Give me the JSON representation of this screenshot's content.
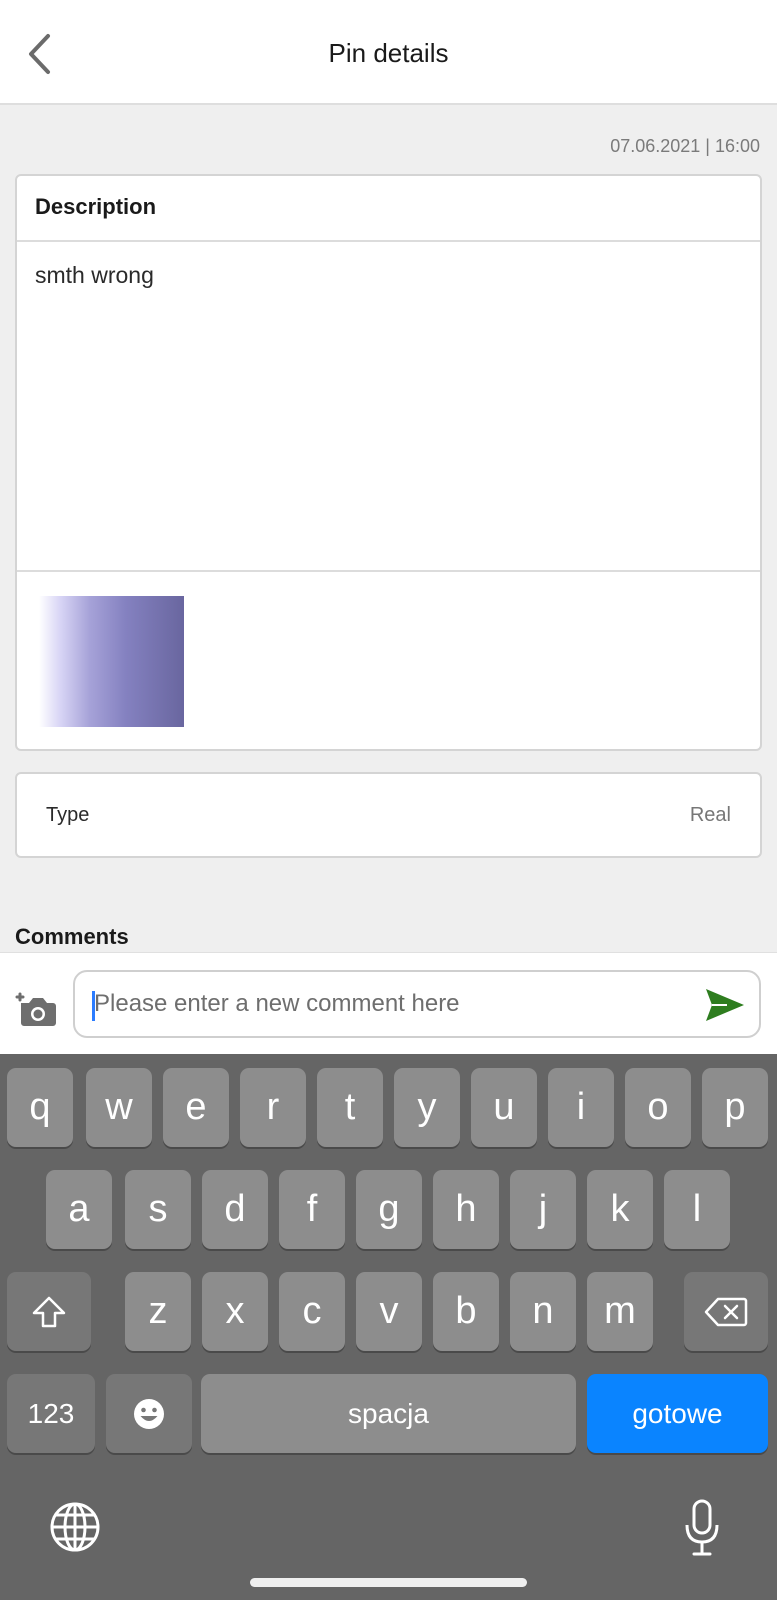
{
  "header": {
    "title": "Pin details",
    "back_icon": "chevron-left-icon"
  },
  "timestamp": "07.06.2021 | 16:00",
  "description": {
    "heading": "Description",
    "text": "smth wrong",
    "attachment_icon": "photo-thumbnail"
  },
  "type_card": {
    "label": "Type",
    "value": "Real"
  },
  "comments": {
    "title": "Comments",
    "input_placeholder": "Please enter a new comment here",
    "input_value": "",
    "camera_icon": "add-photo-icon",
    "send_icon": "send-icon",
    "send_color": "#2e7d1f"
  },
  "keyboard": {
    "row1": [
      "q",
      "w",
      "e",
      "r",
      "t",
      "y",
      "u",
      "i",
      "o",
      "p"
    ],
    "row2": [
      "a",
      "s",
      "d",
      "f",
      "g",
      "h",
      "j",
      "k",
      "l"
    ],
    "row3": [
      "z",
      "x",
      "c",
      "v",
      "b",
      "n",
      "m"
    ],
    "numbers_key": "123",
    "space_key": "spacja",
    "done_key": "gotowe",
    "done_color": "#0a84ff"
  }
}
